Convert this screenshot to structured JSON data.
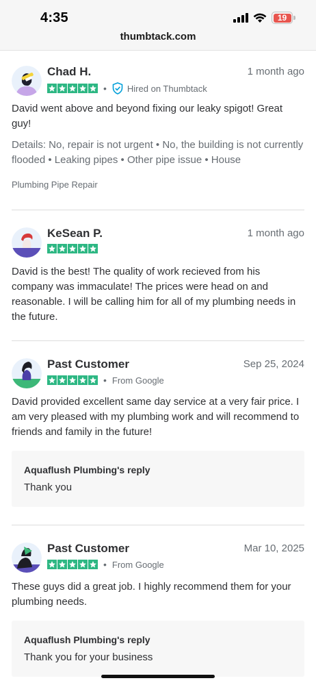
{
  "status_bar": {
    "time": "4:35",
    "battery": "19",
    "battery_color": "#e8554e",
    "url": "thumbtack.com"
  },
  "colors": {
    "star_green": "#2db783",
    "text_primary": "#2f3033",
    "text_secondary": "#676d73",
    "verified_blue": "#009fd9",
    "reply_bg": "#f7f7f7"
  },
  "reviews": [
    {
      "name": "Chad H.",
      "date": "1 month ago",
      "rating": 5,
      "badge": "Hired on Thumbtack",
      "text": "David went above and beyond fixing our leaky spigot! Great guy!",
      "details": "Details: No, repair is not urgent • No, the building is not currently flooded • Leaking pipes • Other pipe issue • House",
      "service": "Plumbing Pipe Repair"
    },
    {
      "name": "KeSean P.",
      "date": "1 month ago",
      "rating": 5,
      "text": "David is the best! The quality of work recieved from his company was immaculate! The prices were head on and reasonable. I will be calling him for all of my plumbing needs in the future."
    },
    {
      "name": "Past Customer",
      "date": "Sep 25, 2024",
      "rating": 5,
      "source": "From Google",
      "text": "David provided excellent same day service at a very fair price. I am very pleased with my plumbing work and will recommend to friends and family in the future!",
      "reply_title": "Aquaflush Plumbing's reply",
      "reply_text": "Thank you"
    },
    {
      "name": "Past Customer",
      "date": "Mar 10, 2025",
      "rating": 5,
      "source": "From Google",
      "text": "These guys did a great job. I highly recommend them for your plumbing needs.",
      "reply_title": "Aquaflush Plumbing's reply",
      "reply_text": "Thank you for your business"
    }
  ]
}
